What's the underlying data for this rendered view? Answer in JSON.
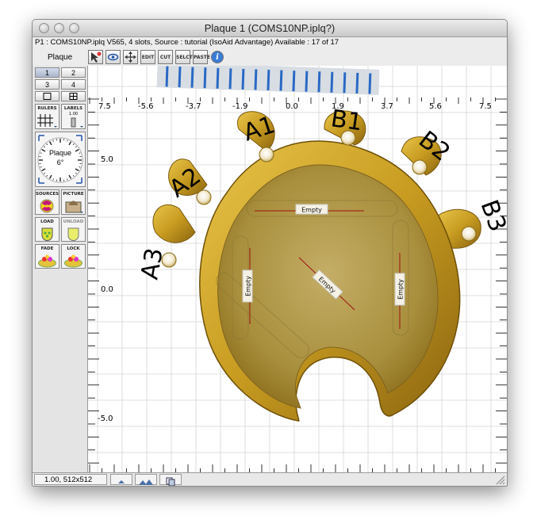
{
  "window": {
    "title": "Plaque 1 (COMS10NP.iplq?)",
    "info": "P1 : COMS10NP.iplq V565, 4 slots, Source : tutorial (IsoAid Advantage) Available : 17 of 17"
  },
  "toolbar": {
    "label": "Plaque",
    "buttons": [
      {
        "label": "",
        "icon": "select-arrow-icon"
      },
      {
        "label": "",
        "icon": "eye-icon"
      },
      {
        "label": "",
        "icon": "move-arrows-icon"
      },
      {
        "label": "EDIT",
        "icon": "edit-icon"
      },
      {
        "label": "CUT",
        "icon": "cut-icon"
      },
      {
        "label": "SELCT",
        "icon": "select-icon"
      },
      {
        "label": "PASTE",
        "icon": "paste-icon"
      },
      {
        "label": "i",
        "icon": "info-icon"
      }
    ]
  },
  "sidebar": {
    "views": [
      "1",
      "2",
      "3",
      "4"
    ],
    "selected_view": "1",
    "rulers_label": "RULERS",
    "labels_label": "LABELS",
    "labels_value": "1.00",
    "dial_label": "Plaque",
    "dial_value": "6°",
    "sources_label": "SOURCES",
    "picture_label": "PICTURE",
    "load_label": "LOAD",
    "unload_label": "UNLOAD",
    "fade_label": "FADE",
    "lock_label": "LOCK"
  },
  "canvas": {
    "x_ticks": [
      "7.5",
      "-5.6",
      "-3.7",
      "-1.9",
      "0.0",
      "1.9",
      "3.7",
      "5.6",
      "7.5"
    ],
    "y_ticks": [
      "5.0",
      "0.0",
      "-5.0"
    ],
    "pin_labels": [
      "A1",
      "B1",
      "A2",
      "B2",
      "A3",
      "B3"
    ],
    "slots": [
      {
        "label": "Empty"
      },
      {
        "label": "Empty"
      },
      {
        "label": "Empty"
      },
      {
        "label": "Empty"
      }
    ]
  },
  "status": {
    "text": "1.00, 512x512",
    "icons": [
      "zoom-small-icon",
      "zoom-large-icon",
      "copy-icon"
    ]
  },
  "colors": {
    "plaque_gold": "#c9a431",
    "plaque_dark": "#8a6a12",
    "slot_line": "#a01010",
    "grid": "#cfcfcf"
  }
}
